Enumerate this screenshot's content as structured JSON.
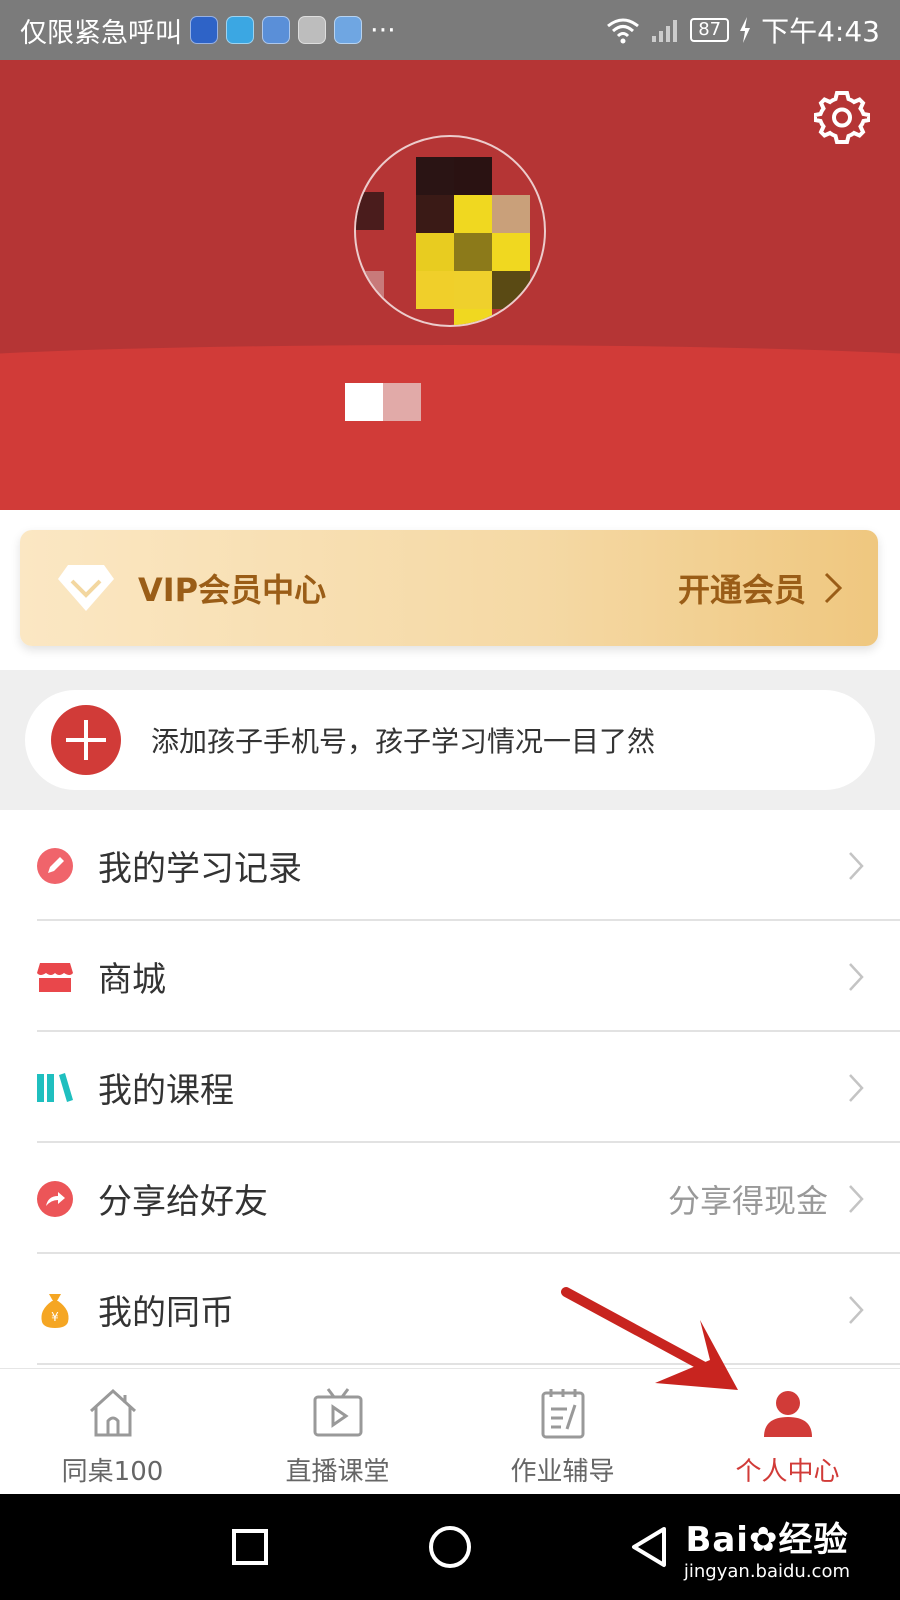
{
  "status_bar": {
    "carrier": "仅限紧急呼叫",
    "more": "···",
    "battery": "87",
    "time": "下午4:43"
  },
  "header": {
    "settings_icon": "gear-icon"
  },
  "vip": {
    "title": "VIP会员中心",
    "cta": "开通会员"
  },
  "add_child": {
    "text": "添加孩子手机号，孩子学习情况一目了然"
  },
  "menu": {
    "items": [
      {
        "label": "我的学习记录",
        "icon": "pencil-icon",
        "extra": ""
      },
      {
        "label": "商城",
        "icon": "store-icon",
        "extra": ""
      },
      {
        "label": "我的课程",
        "icon": "books-icon",
        "extra": ""
      },
      {
        "label": "分享给好友",
        "icon": "share-icon",
        "extra": "分享得现金"
      },
      {
        "label": "我的同币",
        "icon": "money-bag-icon",
        "extra": ""
      }
    ]
  },
  "bottom_nav": {
    "items": [
      {
        "label": "同桌100",
        "icon": "home-icon",
        "active": false
      },
      {
        "label": "直播课堂",
        "icon": "tv-icon",
        "active": false
      },
      {
        "label": "作业辅导",
        "icon": "notepad-icon",
        "active": false
      },
      {
        "label": "个人中心",
        "icon": "person-icon",
        "active": true
      }
    ]
  },
  "watermark": {
    "logo": "Bai",
    "logo2": "经验",
    "url": "jingyan.baidu.com"
  },
  "colors": {
    "brand_red": "#d13b38",
    "header_dark": "#b53535",
    "vip_text": "#9a5d17"
  }
}
